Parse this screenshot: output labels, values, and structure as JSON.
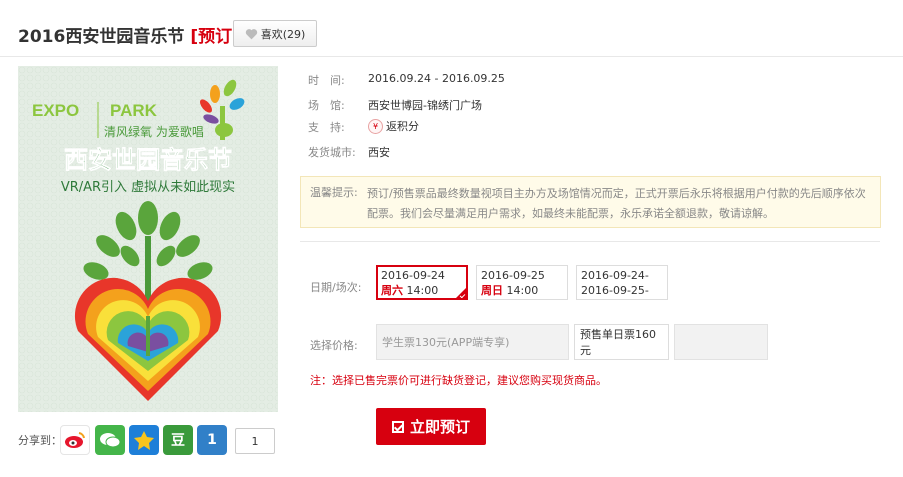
{
  "header": {
    "title": "2016西安世园音乐节",
    "presale_tag": "[预订]",
    "like_label": "喜欢(29)"
  },
  "poster": {
    "logo_left": "EXPO",
    "logo_right": "PARK",
    "slogan": "清风绿氧 为爱歌唱",
    "headline": "西安世园音乐节",
    "subline": "VR/AR引入 虚拟从未如此现实"
  },
  "details": {
    "time_label": "时　间:",
    "time_value": "2016.09.24 - 2016.09.25",
    "venue_label": "场　馆:",
    "venue_value": "西安世博园-锦绣门广场",
    "support_label": "支　持:",
    "support_icon": "yen-icon",
    "support_value": "返积分",
    "city_label": "发货城市:",
    "city_value": "西安"
  },
  "notice": {
    "label": "温馨提示:",
    "text": "预订/预售票品最终数量视项目主办方及场馆情况而定，正式开票后永乐将根据用户付款的先后顺序依次配票。我们会尽量满足用户需求，如最终未能配票，永乐承诺全额退款，敬请谅解。"
  },
  "dates": {
    "label": "日期/场次:",
    "options": [
      {
        "line1": "2016-09-24",
        "weekday": "周六",
        "time": " 14:00",
        "selected": true
      },
      {
        "line1": "2016-09-25",
        "weekday": "周日",
        "time": " 14:00",
        "selected": false
      },
      {
        "line1": "2016-09-24-",
        "line2": "2016-09-25-",
        "selected": false
      }
    ]
  },
  "prices": {
    "label": "选择价格:",
    "options": [
      "学生票130元(APP端专享)",
      "预售单日票160元",
      ""
    ]
  },
  "warning": "注：选择已售完票价可进行缺货登记，建议您购买现货商品。",
  "buy_button": "立即预订",
  "share": {
    "label": "分享到：",
    "count": "1",
    "icons": [
      "weibo-icon",
      "wechat-icon",
      "qzone-icon",
      "douban-icon",
      "share-1-icon"
    ],
    "douban_glyph": "豆",
    "num_glyph": "1"
  },
  "colors": {
    "accent": "#d7000f",
    "notice_bg": "#fffbe9",
    "poster_bg": "#dfe9df"
  }
}
